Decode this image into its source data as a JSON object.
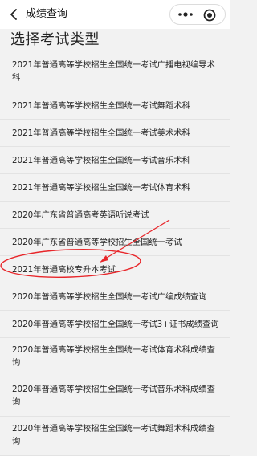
{
  "nav": {
    "title": "成绩查询",
    "back_icon": "chevron-left-icon",
    "more_icon": "more-dots-icon",
    "close_icon": "target-circle-icon"
  },
  "page_title": "选择考试类型",
  "items": [
    {
      "label": "2021年普通高等学校招生全国统一考试广播电视编导术科"
    },
    {
      "label": "2021年普通高等学校招生全国统一考试舞蹈术科"
    },
    {
      "label": "2021年普通高等学校招生全国统一考试美术术科"
    },
    {
      "label": "2021年普通高等学校招生全国统一考试音乐术科"
    },
    {
      "label": "2021年普通高等学校招生全国统一考试体育术科"
    },
    {
      "label": "2020年广东省普通高考英语听说考试"
    },
    {
      "label": "2020年广东省普通高等学校招生全国统一考试"
    },
    {
      "label": "2021年普通高校专升本考试"
    },
    {
      "label": "2020年普通高等学校招生全国统一考试广编成绩查询"
    },
    {
      "label": "2020年普通高等学校招生全国统一考试3+证书成绩查询"
    },
    {
      "label": "2020年普通高等学校招生全国统一考试体育术科成绩查询"
    },
    {
      "label": "2020年普通高等学校招生全国统一考试音乐术科成绩查询"
    },
    {
      "label": "2020年普通高等学校招生全国统一考试舞蹈术科成绩查询"
    }
  ],
  "colors": {
    "annotation": "#e8262a",
    "background": "#f2f2f2",
    "divider": "#e3e3e3"
  }
}
